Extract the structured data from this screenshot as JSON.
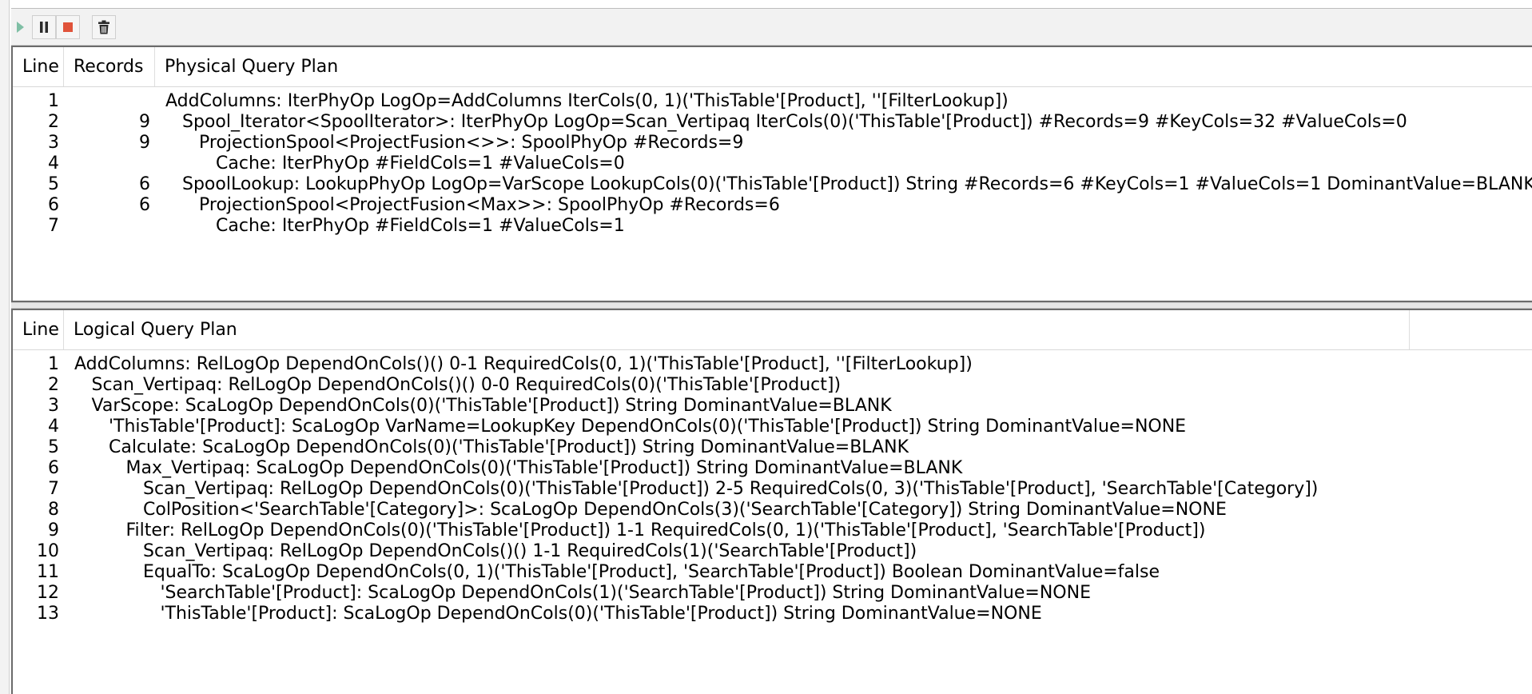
{
  "toolbar": {
    "buttons": [
      {
        "name": "run-button",
        "icon": "play-icon"
      },
      {
        "name": "pause-button",
        "icon": "pause-icon"
      },
      {
        "name": "stop-button",
        "icon": "stop-icon"
      },
      {
        "name": "clear-button",
        "icon": "trash-icon"
      }
    ],
    "colors": {
      "play": "#7fbfa5",
      "stop": "#e0533a",
      "icon": "#2b2b2b"
    }
  },
  "physical": {
    "headers": {
      "line": "Line",
      "records": "Records",
      "plan": "Physical Query Plan"
    },
    "rows": [
      {
        "line": "1",
        "records": "",
        "indent": 0,
        "text": "AddColumns: IterPhyOp LogOp=AddColumns IterCols(0, 1)('ThisTable'[Product], ''[FilterLookup])"
      },
      {
        "line": "2",
        "records": "9",
        "indent": 1,
        "text": "Spool_Iterator<SpoolIterator>: IterPhyOp LogOp=Scan_Vertipaq IterCols(0)('ThisTable'[Product]) #Records=9 #KeyCols=32 #ValueCols=0"
      },
      {
        "line": "3",
        "records": "9",
        "indent": 2,
        "text": "ProjectionSpool<ProjectFusion<>>: SpoolPhyOp #Records=9"
      },
      {
        "line": "4",
        "records": "",
        "indent": 3,
        "text": "Cache: IterPhyOp #FieldCols=1 #ValueCols=0"
      },
      {
        "line": "5",
        "records": "6",
        "indent": 1,
        "text": "SpoolLookup: LookupPhyOp LogOp=VarScope LookupCols(0)('ThisTable'[Product]) String #Records=6 #KeyCols=1 #ValueCols=1 DominantValue=BLANK"
      },
      {
        "line": "6",
        "records": "6",
        "indent": 2,
        "text": "ProjectionSpool<ProjectFusion<Max>>: SpoolPhyOp #Records=6"
      },
      {
        "line": "7",
        "records": "",
        "indent": 3,
        "text": "Cache: IterPhyOp #FieldCols=1 #ValueCols=1"
      }
    ]
  },
  "logical": {
    "headers": {
      "line": "Line",
      "plan": "Logical Query Plan"
    },
    "rows": [
      {
        "line": "1",
        "indent": 0,
        "text": "AddColumns: RelLogOp DependOnCols()() 0-1 RequiredCols(0, 1)('ThisTable'[Product], ''[FilterLookup])"
      },
      {
        "line": "2",
        "indent": 1,
        "text": "Scan_Vertipaq: RelLogOp DependOnCols()() 0-0 RequiredCols(0)('ThisTable'[Product])"
      },
      {
        "line": "3",
        "indent": 1,
        "text": "VarScope: ScaLogOp DependOnCols(0)('ThisTable'[Product]) String DominantValue=BLANK"
      },
      {
        "line": "4",
        "indent": 2,
        "text": "'ThisTable'[Product]: ScaLogOp VarName=LookupKey DependOnCols(0)('ThisTable'[Product]) String DominantValue=NONE"
      },
      {
        "line": "5",
        "indent": 2,
        "text": "Calculate: ScaLogOp DependOnCols(0)('ThisTable'[Product]) String DominantValue=BLANK"
      },
      {
        "line": "6",
        "indent": 3,
        "text": "Max_Vertipaq: ScaLogOp DependOnCols(0)('ThisTable'[Product]) String DominantValue=BLANK"
      },
      {
        "line": "7",
        "indent": 4,
        "text": "Scan_Vertipaq: RelLogOp DependOnCols(0)('ThisTable'[Product]) 2-5 RequiredCols(0, 3)('ThisTable'[Product], 'SearchTable'[Category])"
      },
      {
        "line": "8",
        "indent": 4,
        "text": "ColPosition<'SearchTable'[Category]>: ScaLogOp DependOnCols(3)('SearchTable'[Category]) String DominantValue=NONE"
      },
      {
        "line": "9",
        "indent": 3,
        "text": "Filter: RelLogOp DependOnCols(0)('ThisTable'[Product]) 1-1 RequiredCols(0, 1)('ThisTable'[Product], 'SearchTable'[Product])"
      },
      {
        "line": "10",
        "indent": 4,
        "text": "Scan_Vertipaq: RelLogOp DependOnCols()() 1-1 RequiredCols(1)('SearchTable'[Product])"
      },
      {
        "line": "11",
        "indent": 4,
        "text": "EqualTo: ScaLogOp DependOnCols(0, 1)('ThisTable'[Product], 'SearchTable'[Product]) Boolean DominantValue=false"
      },
      {
        "line": "12",
        "indent": 5,
        "text": "'SearchTable'[Product]: ScaLogOp DependOnCols(1)('SearchTable'[Product]) String DominantValue=NONE"
      },
      {
        "line": "13",
        "indent": 5,
        "text": "'ThisTable'[Product]: ScaLogOp DependOnCols(0)('ThisTable'[Product]) String DominantValue=NONE"
      }
    ]
  }
}
